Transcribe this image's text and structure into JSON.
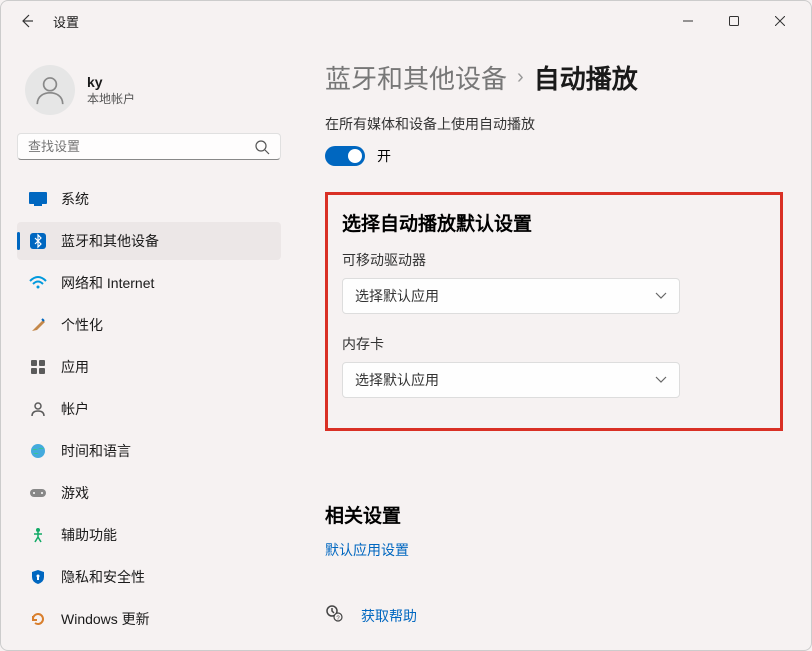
{
  "titlebar": {
    "title": "设置"
  },
  "user": {
    "name": "ky",
    "sub": "本地帐户"
  },
  "search": {
    "placeholder": "查找设置"
  },
  "sidebar": {
    "items": [
      {
        "label": "系统"
      },
      {
        "label": "蓝牙和其他设备"
      },
      {
        "label": "网络和 Internet"
      },
      {
        "label": "个性化"
      },
      {
        "label": "应用"
      },
      {
        "label": "帐户"
      },
      {
        "label": "时间和语言"
      },
      {
        "label": "游戏"
      },
      {
        "label": "辅助功能"
      },
      {
        "label": "隐私和安全性"
      },
      {
        "label": "Windows 更新"
      }
    ]
  },
  "breadcrumb": {
    "parent": "蓝牙和其他设备",
    "current": "自动播放"
  },
  "autoplay": {
    "label": "在所有媒体和设备上使用自动播放",
    "state": "开"
  },
  "defaults": {
    "title": "选择自动播放默认设置",
    "removable": {
      "label": "可移动驱动器",
      "value": "选择默认应用"
    },
    "memcard": {
      "label": "内存卡",
      "value": "选择默认应用"
    }
  },
  "related": {
    "title": "相关设置",
    "link": "默认应用设置"
  },
  "help": {
    "label": "获取帮助"
  }
}
